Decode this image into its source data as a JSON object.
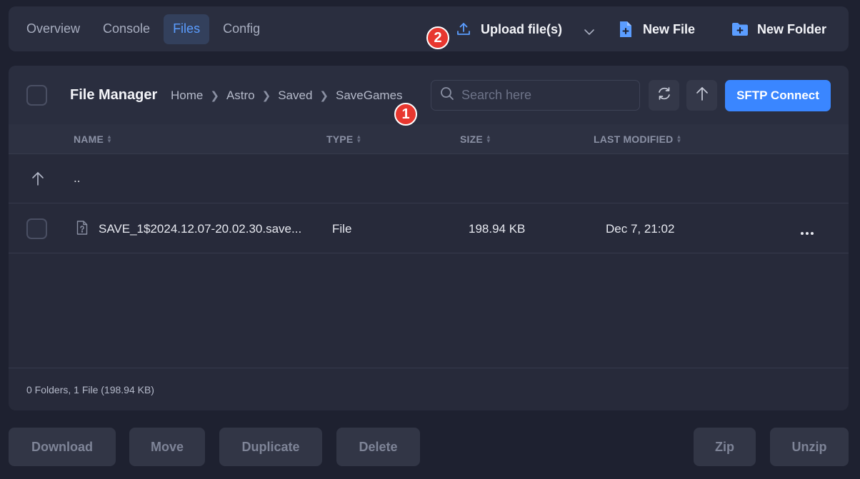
{
  "tabs": [
    {
      "label": "Overview",
      "active": false
    },
    {
      "label": "Console",
      "active": false
    },
    {
      "label": "Files",
      "active": true
    },
    {
      "label": "Config",
      "active": false
    }
  ],
  "actions": {
    "upload_label": "Upload file(s)",
    "new_file_label": "New File",
    "new_folder_label": "New Folder"
  },
  "badges": {
    "one": "1",
    "two": "2"
  },
  "file_manager": {
    "title": "File Manager",
    "breadcrumb": [
      "Home",
      "Astro",
      "Saved",
      "SaveGames"
    ],
    "search_placeholder": "Search here",
    "sftp_label": "SFTP Connect",
    "columns": {
      "name": "NAME",
      "type": "TYPE",
      "size": "SIZE",
      "modified": "LAST MODIFIED"
    },
    "parent_label": "..",
    "files": [
      {
        "name": "SAVE_1$2024.12.07-20.02.30.save...",
        "type": "File",
        "size": "198.94 KB",
        "modified": "Dec 7, 21:02"
      }
    ],
    "summary": "0 Folders, 1 File (198.94 KB)"
  },
  "bottom_buttons": {
    "download": "Download",
    "move": "Move",
    "duplicate": "Duplicate",
    "delete": "Delete",
    "zip": "Zip",
    "unzip": "Unzip"
  },
  "colors": {
    "accent": "#3a86ff",
    "badge": "#e8372f",
    "active_tab_text": "#5b9dff"
  }
}
